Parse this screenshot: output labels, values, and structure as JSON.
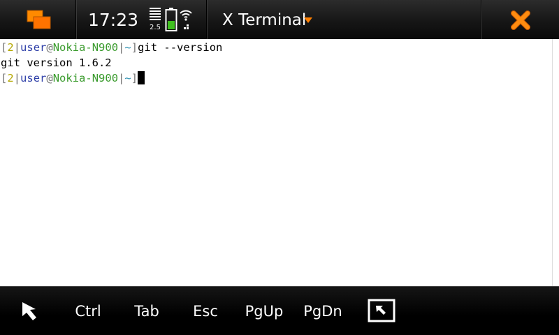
{
  "statusbar": {
    "time": "17:23",
    "signal_value": "2.5",
    "title": "X Terminal",
    "accent_color": "#ff7f00",
    "icons": {
      "task_switcher": "task-switcher-icon",
      "battery": "battery-icon",
      "wifi": "wifi-icon",
      "menu_arrow": "chevron-down-icon",
      "close": "close-icon"
    }
  },
  "terminal": {
    "prompt": {
      "open": "[",
      "num": "2",
      "sep1": "|",
      "user": "user",
      "at": "@",
      "host": "Nokia-N900",
      "sep2": "|",
      "dir": "~",
      "close": "]"
    },
    "command1": "git --version",
    "output1": "git version 1.6.2"
  },
  "keybar": {
    "pointer_icon": "pointer-icon",
    "ctrl": "Ctrl",
    "tab": "Tab",
    "esc": "Esc",
    "pgup": "PgUp",
    "pgdn": "PgDn",
    "fullscreen_icon": "fullscreen-icon"
  }
}
